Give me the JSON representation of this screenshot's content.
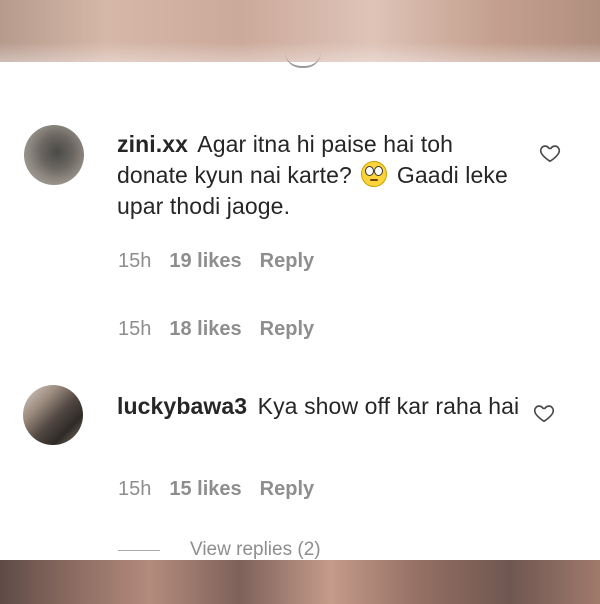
{
  "comments": [
    {
      "username": "zini.xx",
      "text_before_emoji": "Agar itna hi paise hai toh donate kyun nai karte?",
      "emoji": "face-with-rolling-eyes",
      "text_after_emoji": "Gaadi leke upar thodi jaoge.",
      "time": "15h",
      "likes": "19 likes",
      "reply_label": "Reply"
    },
    {
      "time": "15h",
      "likes": "18 likes",
      "reply_label": "Reply"
    },
    {
      "username": "luckybawa3",
      "text": "Kya show off kar raha hai",
      "time": "15h",
      "likes": "15 likes",
      "reply_label": "Reply",
      "view_replies": "View replies (2)"
    }
  ],
  "icons": {
    "like": "heart-outline-icon",
    "sheet_handle": "chevron-handle"
  },
  "colors": {
    "text": "#262626",
    "secondary": "#8e8e8e"
  }
}
